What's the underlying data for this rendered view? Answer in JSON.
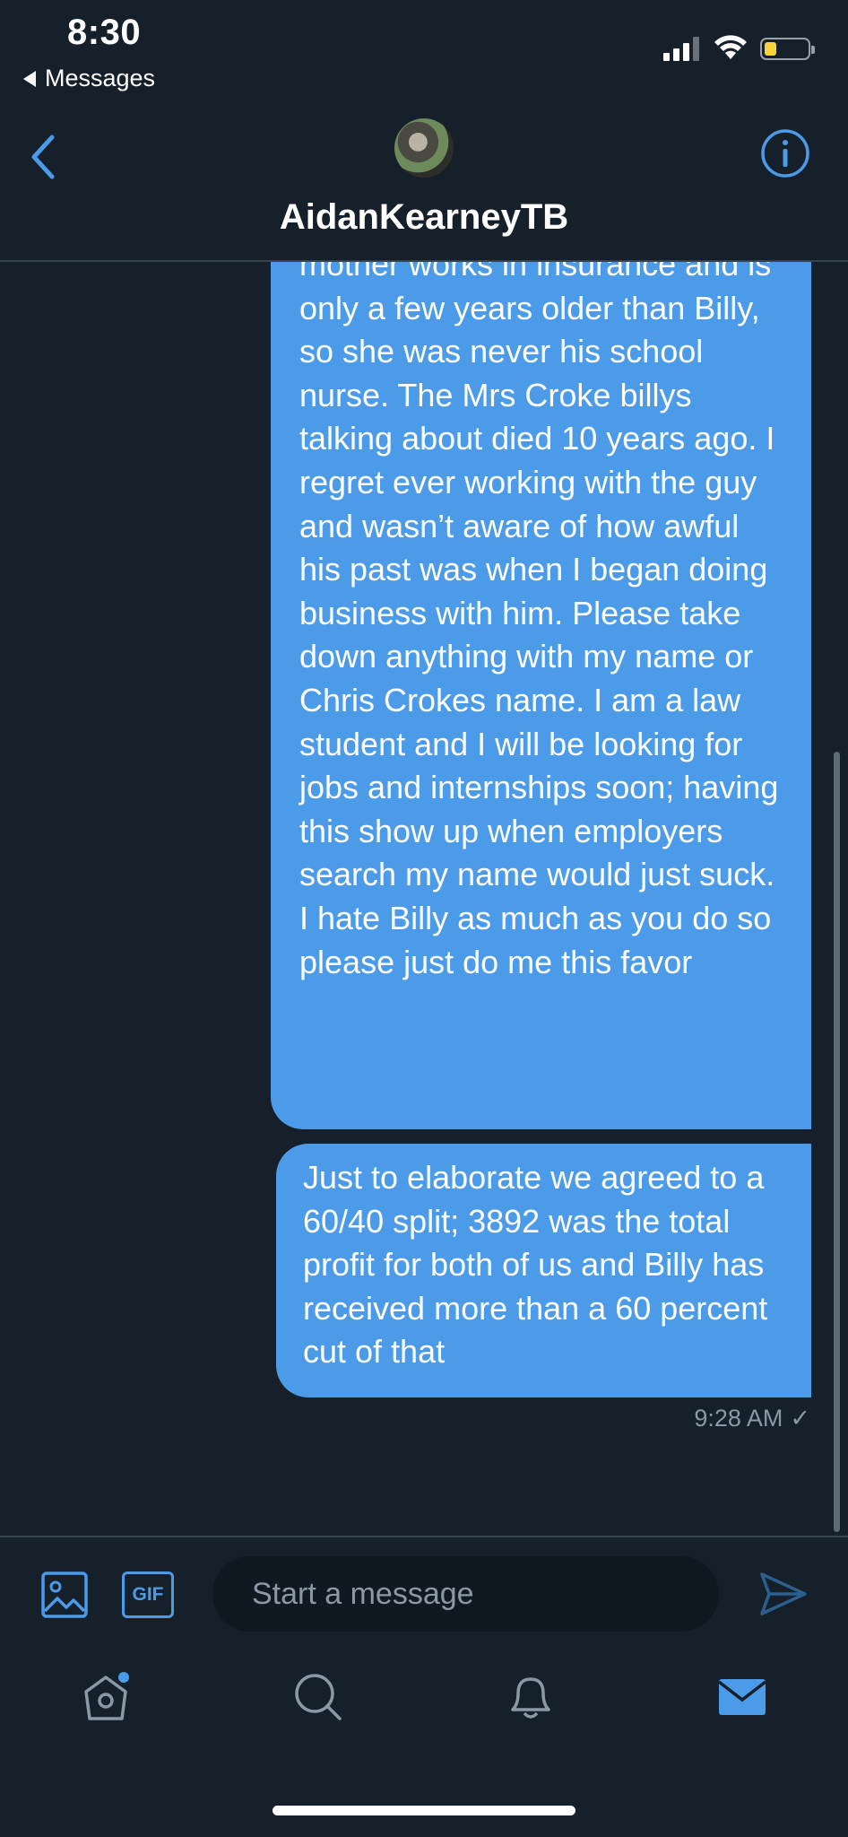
{
  "status_bar": {
    "time": "8:30",
    "back_app": "Messages"
  },
  "header": {
    "title": "AidanKearneyTB"
  },
  "messages": [
    {
      "text": "mother works in insurance and is only a few years older than Billy, so she was never his school nurse. The Mrs Croke billys talking about died 10 years ago. I regret ever working with the guy and wasn’t aware of how awful his past was when I began doing business with him. Please take down anything with my name or Chris Crokes name. I am a law student and I will be looking for jobs and internships soon; having this show up when employers search my name would just suck. I hate Billy as much as you do so please just do me this favor"
    },
    {
      "text": "Just to elaborate we agreed to a 60/40 split; 3892 was the total profit for both of us and Billy has received more than a 60 percent cut of that"
    }
  ],
  "timestamp": "9:28 AM",
  "composer": {
    "gif_label": "GIF",
    "placeholder": "Start a message"
  },
  "colors": {
    "background": "#15202b",
    "accent": "#4c9be8",
    "bubble": "#4c9be8",
    "muted": "#8b98a5"
  },
  "icons": [
    "back-chevron-icon",
    "info-icon",
    "image-icon",
    "gif-icon",
    "send-icon",
    "home-icon",
    "search-icon",
    "bell-icon",
    "mail-icon"
  ]
}
